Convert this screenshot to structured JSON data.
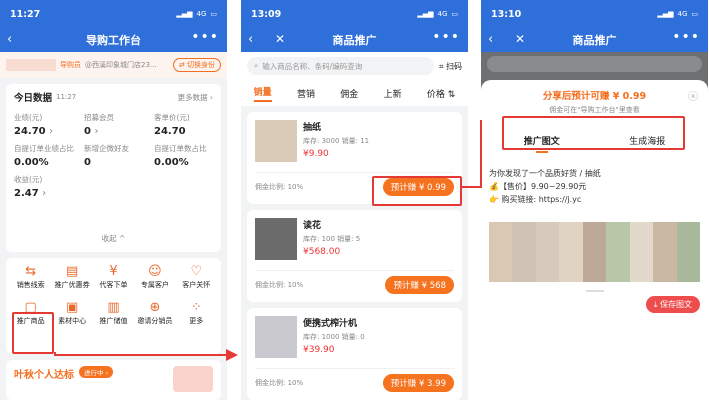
{
  "p1": {
    "time": "11:27",
    "signal": "4G",
    "title": "导购工作台",
    "store_tag": "导购员",
    "store_name": "@西溪印象城门店23...",
    "switch_label": "切换身份",
    "today_title": "今日数据",
    "today_time": "11:27",
    "more_data": "更多数据 ›",
    "stats": [
      {
        "label": "业绩(元)",
        "value": "24.70",
        "arrow": "›"
      },
      {
        "label": "招募会员",
        "value": "0",
        "arrow": "›"
      },
      {
        "label": "客单价(元)",
        "value": "24.70",
        "arrow": ""
      },
      {
        "label": "自提订单业绩占比",
        "value": "0.00%",
        "arrow": ""
      },
      {
        "label": "新增企微好友",
        "value": "0",
        "arrow": ""
      },
      {
        "label": "自提订单数占比",
        "value": "0.00%",
        "arrow": ""
      },
      {
        "label": "收益(元)",
        "value": "2.47",
        "arrow": "›"
      }
    ],
    "collapse": "收起 ^",
    "menu": [
      "销售线索",
      "推广优惠券",
      "代客下单",
      "专属客户",
      "客户关怀",
      "推广商品",
      "素材中心",
      "推广储值",
      "邀请分销员",
      "更多"
    ],
    "promo_title": "叶秋个人达标",
    "promo_badge": "进行中 ›"
  },
  "p2": {
    "time": "13:09",
    "signal": "4G",
    "title": "商品推广",
    "search_placeholder": "输入商品名称、条码/编码查询",
    "scan": "扫码",
    "tabs": [
      "销量",
      "营销",
      "佣金",
      "上新",
      "价格 ⇅"
    ],
    "items": [
      {
        "name": "抽纸",
        "stock": "库存: 3000   销量: 11",
        "price": "¥9.90",
        "commission": "佣金比例: 10%",
        "btn": "预计赚 ¥ 0.99"
      },
      {
        "name": "读花",
        "stock": "库存: 100   销量: 5",
        "price": "¥568.00",
        "commission": "佣金比例: 10%",
        "btn": "预计赚 ¥ 568"
      },
      {
        "name": "便携式榨汁机",
        "stock": "库存: 1000   销量: 0",
        "price": "¥39.90",
        "commission": "佣金比例: 10%",
        "btn": "预计赚 ¥ 3.99"
      }
    ]
  },
  "p3": {
    "time": "13:10",
    "signal": "4G",
    "title": "商品推广",
    "share_title": "分享后预计可赚 ¥ 0.99",
    "share_sub": "佣金可在\"导购工作台\"里查看",
    "tab_active": "推广图文",
    "tab_other": "生成海报",
    "line1": "为你发现了一个品质好货 /     抽纸",
    "line2": "💰【售价】9.90~29.90元",
    "line3": "👉 购买链接: https://j.yc",
    "save": "保存图文"
  }
}
